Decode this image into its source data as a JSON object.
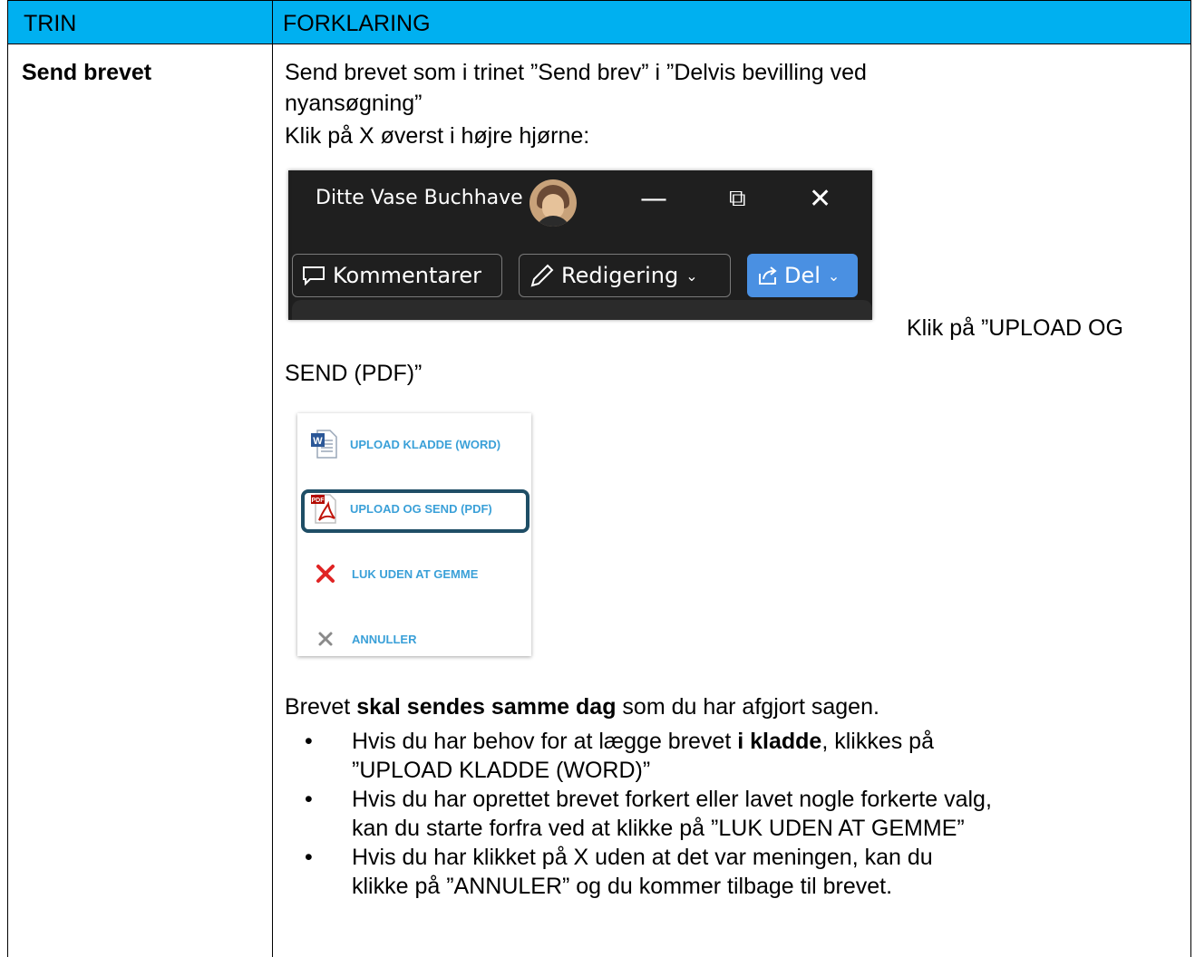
{
  "header": {
    "col1": "TRIN",
    "col2": "FORKLARING"
  },
  "row": {
    "step": "Send brevet",
    "intro_line1": "Send brevet som i trinet ”Send brev” i ”Delvis bevilling ved",
    "intro_line2": "nyansøgning”",
    "intro_line3": "Klik på X øverst i højre hjørne:",
    "upload_line1": "Klik på ”UPLOAD OG",
    "upload_line2": "SEND (PDF)”",
    "para_prefix": "Brevet ",
    "para_bold": "skal sendes samme dag",
    "para_suffix": " som du har afgjort sagen.",
    "bullet1_a": "Hvis du har behov for at lægge brevet ",
    "bullet1_bold": "i kladde",
    "bullet1_b": ", klikkes på",
    "bullet1_line2": "”UPLOAD KLADDE (WORD)”",
    "bullet2_line1": "Hvis du har oprettet brevet forkert eller lavet nogle forkerte valg,",
    "bullet2_line2": "kan du starte forfra ved at klikke på ”LUK UDEN AT GEMME”",
    "bullet3_line1": "Hvis du har klikket på X uden at det var meningen, kan du",
    "bullet3_line2": "klikke på ”ANNULER” og du kommer tilbage til brevet.",
    "bullet_glyph": "•"
  },
  "window_chrome": {
    "user_name": "Ditte Vase Buchhave",
    "minimize": "—",
    "restore": "⧉",
    "close": "✕",
    "comments_label": "Kommentarer",
    "editing_label": "Redigering",
    "share_label": "Del",
    "chevron": "⌄",
    "accent": "#4a90e2"
  },
  "menu": {
    "items": [
      {
        "label": "UPLOAD KLADDE (WORD)",
        "icon": "word-doc-icon"
      },
      {
        "label": "UPLOAD OG SEND (PDF)",
        "icon": "pdf-icon"
      },
      {
        "label": "LUK UDEN AT GEMME",
        "icon": "red-x-icon"
      },
      {
        "label": "ANNULLER",
        "icon": "gray-x-icon"
      }
    ],
    "label_color": "#3aa0d8",
    "highlight_color": "#1f4e66"
  }
}
